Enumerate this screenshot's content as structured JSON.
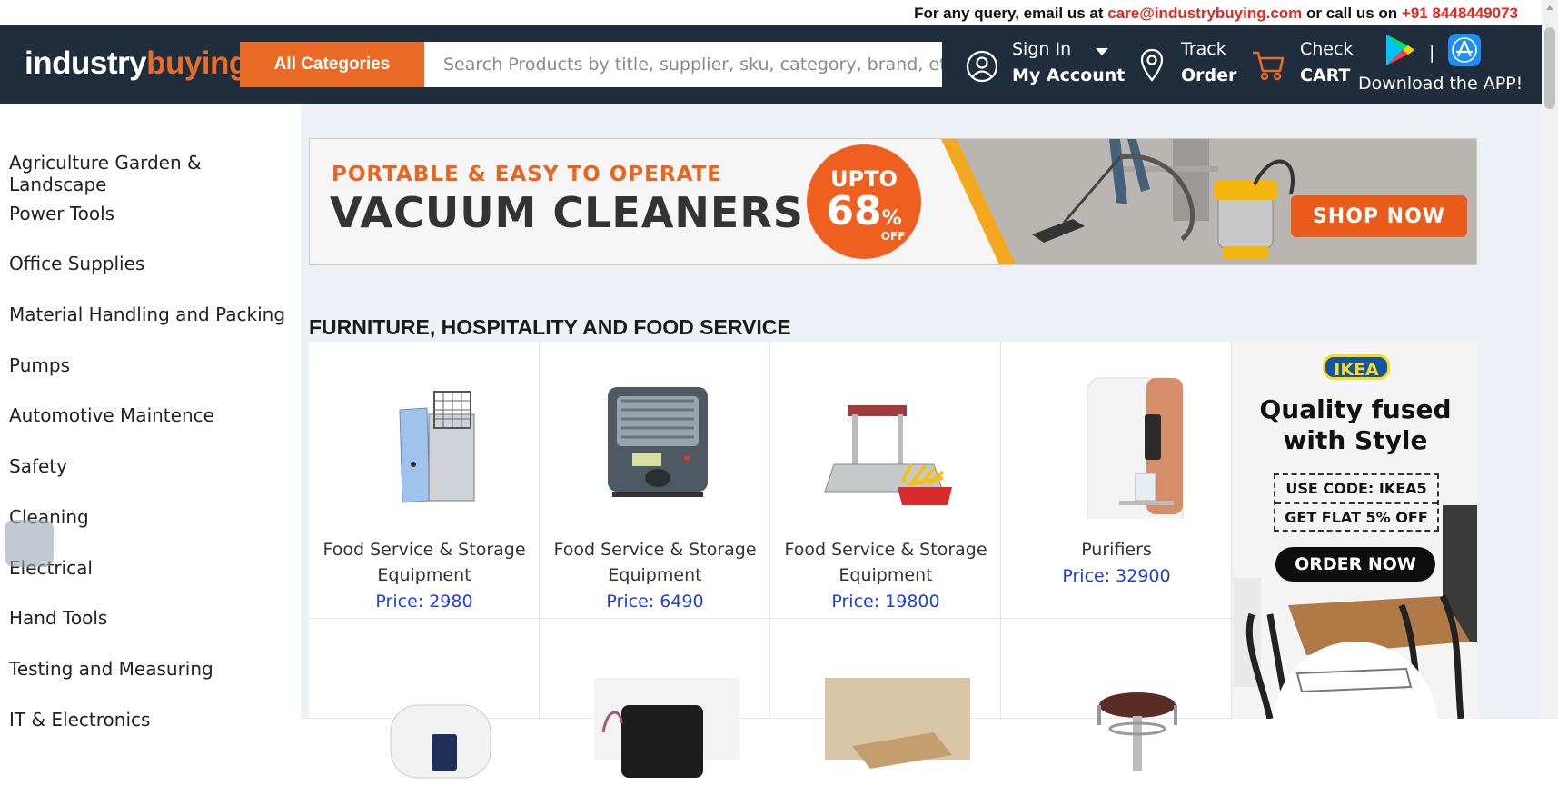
{
  "topbar": {
    "prefix": "For any query, email us at ",
    "email": "care@industrybuying.com",
    "middle": " or call us on ",
    "phone": "+91 8448449073"
  },
  "header": {
    "logo_part1": "industry",
    "logo_part2": "buying",
    "all_categories": "All Categories",
    "search_placeholder": "Search Products by title, supplier, sku, category, brand, etc..",
    "signin": "Sign In",
    "account": "My Account",
    "track": "Track",
    "order": "Order",
    "check": "Check",
    "cart": "CART",
    "app_sep": "|",
    "download": "Download the APP!"
  },
  "sidebar": {
    "items": [
      "Agriculture Garden & Landscape",
      "Power Tools",
      "Office Supplies",
      "Material Handling and Packing",
      "Pumps",
      "Automotive Maintence",
      "Safety",
      "Cleaning",
      "Electrical",
      "Hand Tools",
      "Testing and Measuring",
      "IT & Electronics"
    ]
  },
  "banner": {
    "line1": "PORTABLE & EASY TO OPERATE",
    "line2": "VACUUM CLEANERS",
    "upto": "UPTO",
    "pct": "68",
    "pct_sign": "%",
    "off": "OFF",
    "cta": "SHOP NOW"
  },
  "section": {
    "title": "FURNITURE, HOSPITALITY AND FOOD SERVICE",
    "products": [
      {
        "name": "Food Service & Storage Equipment",
        "price": "Price: 2980"
      },
      {
        "name": "Food Service & Storage Equipment",
        "price": "Price: 6490"
      },
      {
        "name": "Food Service & Storage Equipment",
        "price": "Price: 19800"
      },
      {
        "name": "Purifiers",
        "price": "Price: 32900"
      }
    ]
  },
  "ikea": {
    "brand": "IKEA",
    "headline1": "Quality fused",
    "headline2": "with Style",
    "code": "USE CODE: IKEA5",
    "flat": "GET FLAT 5% OFF",
    "cta": "ORDER NOW"
  }
}
